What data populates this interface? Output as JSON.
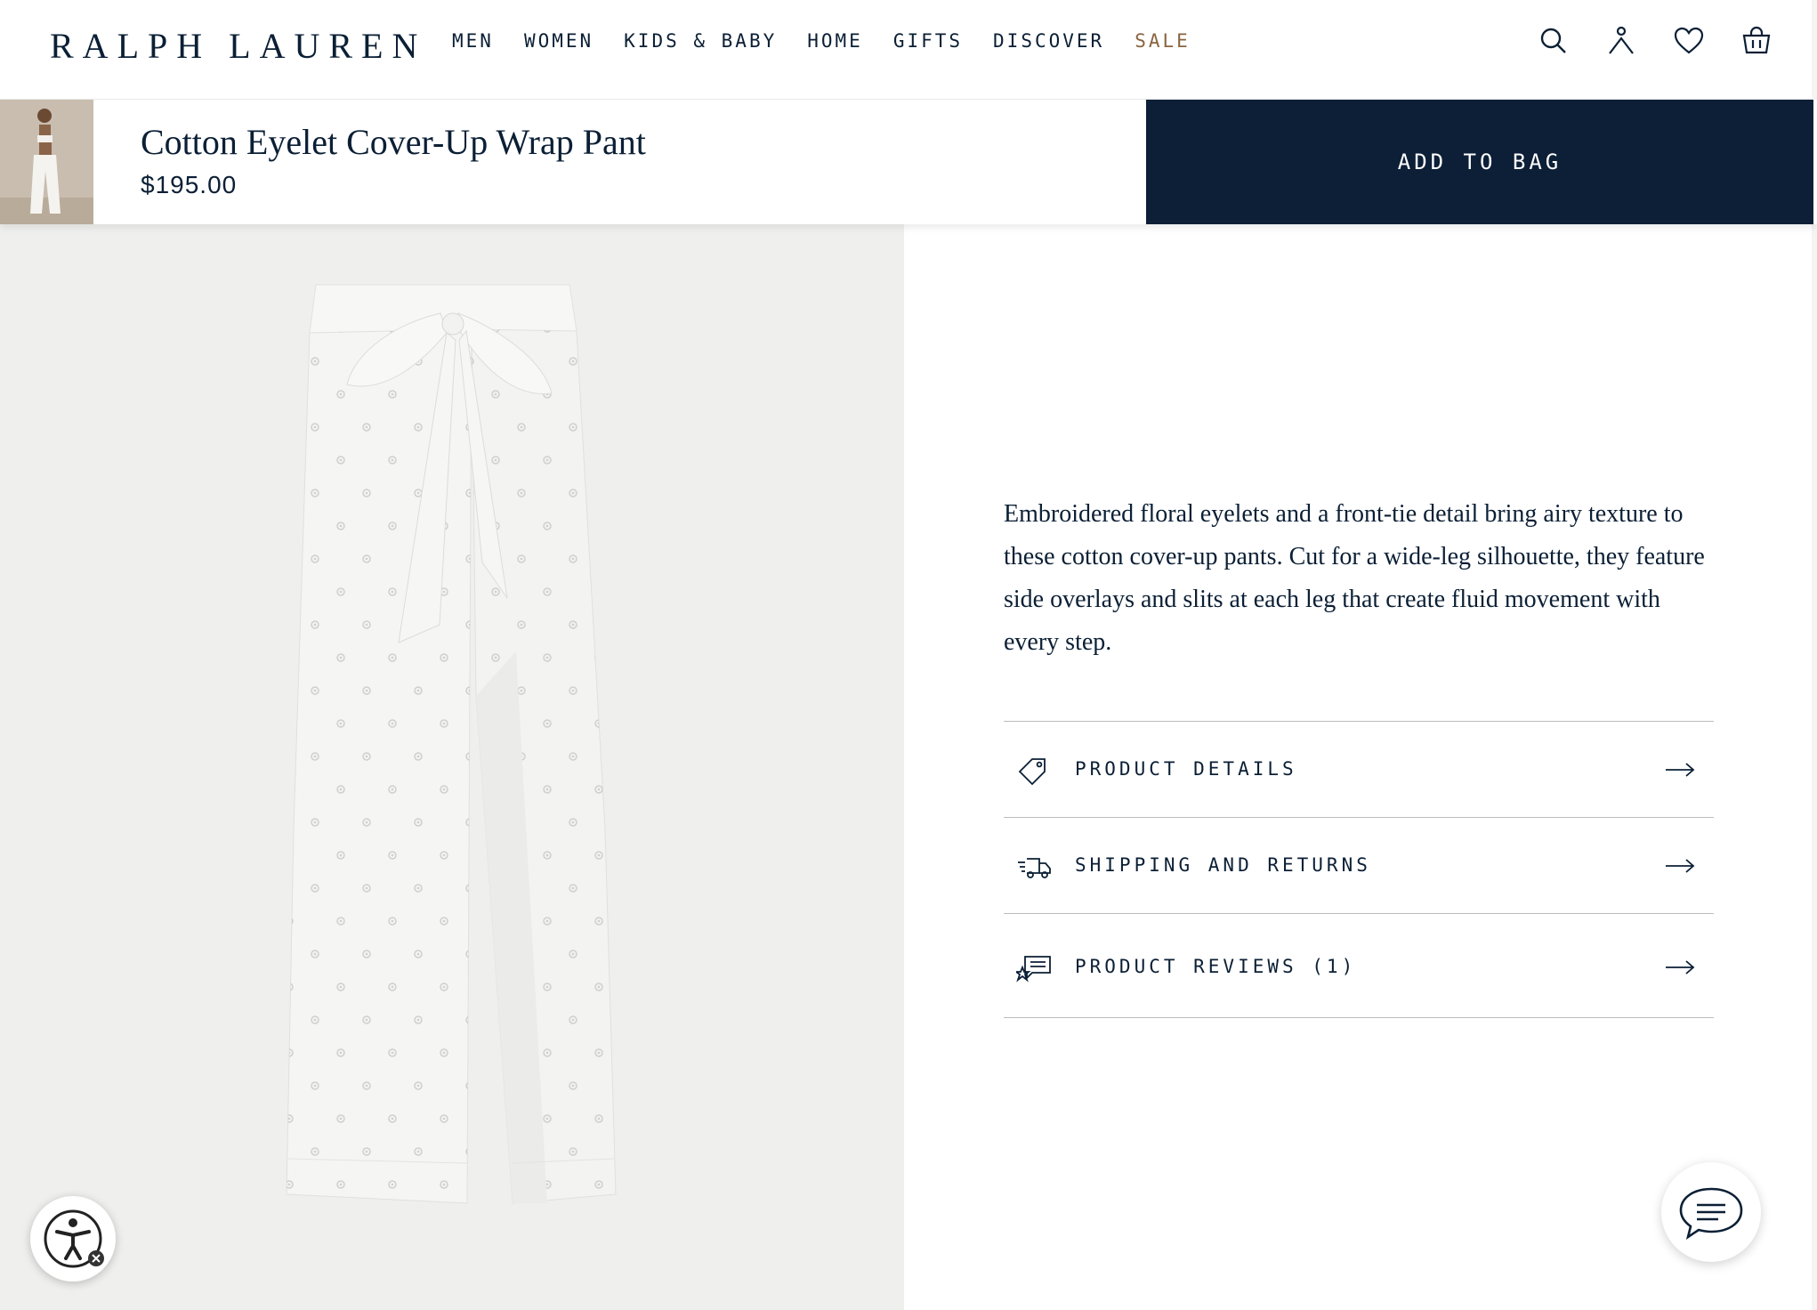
{
  "header": {
    "logo": "RALPH LAUREN",
    "nav": [
      "MEN",
      "WOMEN",
      "KIDS & BABY",
      "HOME",
      "GIFTS",
      "DISCOVER",
      "SALE"
    ],
    "icons": [
      "search-icon",
      "account-icon",
      "wishlist-heart-icon",
      "shopping-bag-icon"
    ]
  },
  "sticky_bar": {
    "title": "Cotton Eyelet Cover-Up Wrap Pant",
    "price": "$195.00",
    "add_to_bag": "ADD TO BAG"
  },
  "product": {
    "description": "Embroidered floral eyelets and a front-tie detail bring airy texture to these cotton cover-up pants. Cut for a wide-leg silhouette, they feature side overlays and slits at each leg that create fluid movement with every step.",
    "accordion": [
      {
        "label": "PRODUCT DETAILS",
        "icon": "tag-icon"
      },
      {
        "label": "SHIPPING AND RETURNS",
        "icon": "delivery-truck-icon"
      },
      {
        "label": "PRODUCT REVIEWS (1)",
        "icon": "reviews-chat-icon"
      }
    ]
  },
  "colors": {
    "navy": "#0c1f37",
    "sale": "#8a6440",
    "image_bg": "#efefed"
  }
}
